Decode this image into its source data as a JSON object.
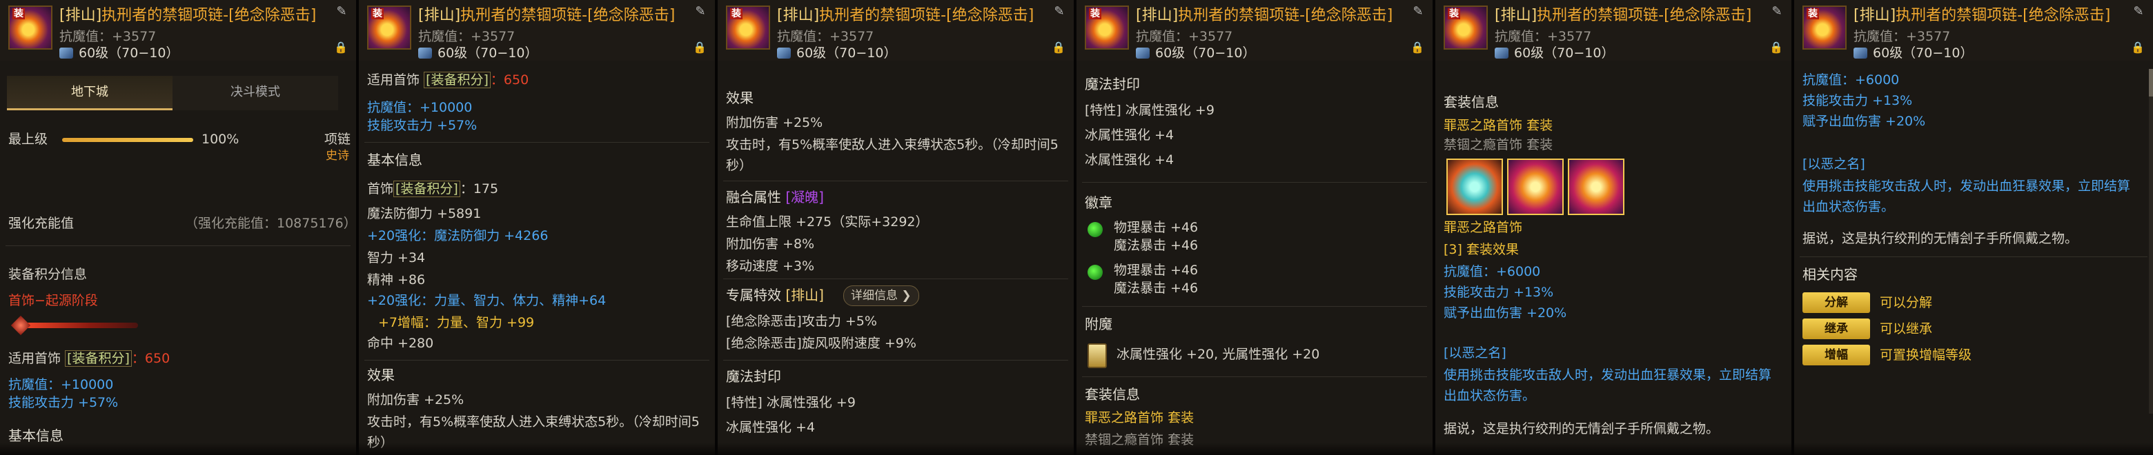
{
  "item": {
    "tag": "[排山]",
    "name": "执刑者的禁锢项链-[绝念除恶击]",
    "resist_label": "抗魔值：+3577",
    "level": "60级（70−10）",
    "thumb_badge": "装"
  },
  "tabs": {
    "active": "地下城",
    "inactive": "决斗模式"
  },
  "reinforce": {
    "max_label": "最上级",
    "progress_value": 1.0,
    "percent": "100%",
    "slot_label": "项链",
    "rarity": "史诗",
    "charge_label": "强化充能值",
    "charge_value": "（强化充能值：10875176）"
  },
  "equip_points": {
    "header": "装备积分信息",
    "stage": "首饰−起源阶段",
    "applies": "适用首饰",
    "points_label": "[装备积分]",
    "points_value": "：650",
    "line1": "抗魔值：+10000",
    "line2": "技能攻击力 +57%"
  },
  "basic": {
    "header": "基本信息",
    "points_prefix": "首饰",
    "points_label": "[装备积分]",
    "points_value": "：175",
    "mdef": "魔法防御力 +5891",
    "mdef_plus": "+20强化：魔法防御力 +4266",
    "int": "智力 +34",
    "spirit": "精神 +86",
    "plus20": "+20强化：力量、智力、体力、精神+64",
    "plus7": "+7增幅：力量、智力 +99",
    "hit": "命中 +280"
  },
  "effect": {
    "header": "效果",
    "line1": "附加伤害 +25%",
    "line2": "攻击时，有5%概率使敌人进入束缚状态5秒。（冷却时间5",
    "line3": "秒）"
  },
  "fusion": {
    "header": "融合属性",
    "tag": "[凝魄]",
    "hp": "生命值上限 +275（实际+3292）",
    "dmg": "附加伤害 +8%",
    "speed": "移动速度 +3%"
  },
  "special": {
    "header": "专属特效",
    "tag": "[排山]",
    "detail_btn": "详细信息",
    "line1": "[绝念除恶击]攻击力 +5%",
    "line2": "[绝念除恶击]旋风吸附速度 +9%"
  },
  "seal": {
    "header": "魔法封印",
    "line1": "[特性] 冰属性强化 +9",
    "line2": "冰属性强化 +4",
    "line3": "冰属性强化 +4"
  },
  "emblem": {
    "header": "徽章",
    "e1a": "物理暴击 +46",
    "e1b": "魔法暴击 +46",
    "e2a": "物理暴击 +46",
    "e2b": "魔法暴击 +46"
  },
  "enchant": {
    "header": "附魔",
    "line": "冰属性强化 +20, 光属性强化 +20"
  },
  "setinfo": {
    "header": "套装信息",
    "set1": "罪恶之路首饰",
    "set1_tag": "套装",
    "set2": "禁锢之瘾首饰",
    "set2_tag": "套装",
    "set1_again": "罪恶之路首饰",
    "count": "[3] 套装效果",
    "s1": "抗魔值：+6000",
    "s2": "技能攻击力 +13%",
    "s3": "赋予出血伤害 +20%",
    "name_tag": "[以恶之名]",
    "desc1": "使用挑击技能攻击敌人时，发动出血狂暴效果，立即结算",
    "desc2": "出血状态伤害。",
    "lore": "据说，这是执行绞刑的无情刽子手所佩戴之物。"
  },
  "related": {
    "header": "相关内容",
    "btn1": "分解",
    "desc1": "可以分解",
    "btn2": "继承",
    "desc2": "可以继承",
    "btn3": "增幅",
    "desc3": "可置换增幅等级"
  }
}
